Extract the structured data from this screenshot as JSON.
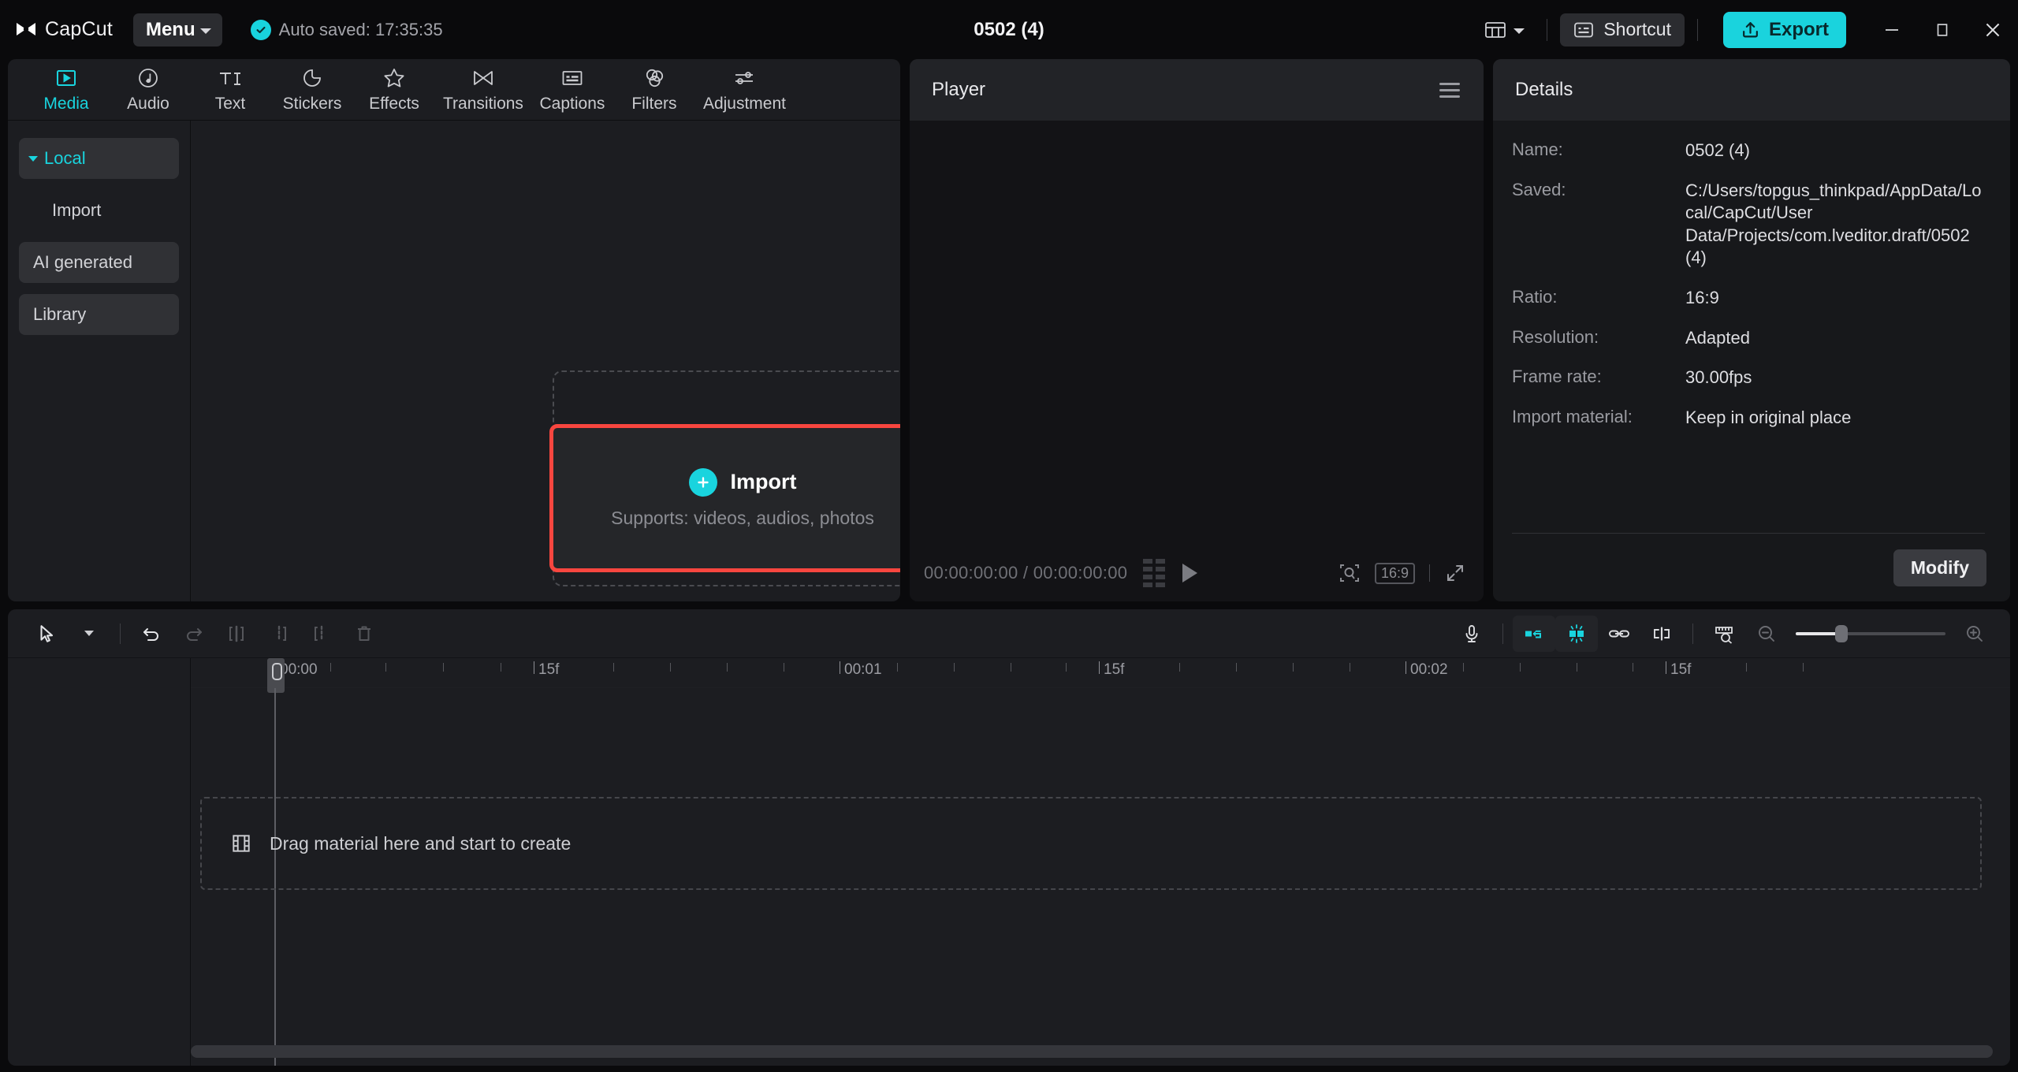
{
  "app": {
    "brand": "CapCut",
    "menu_label": "Menu",
    "autosave": "Auto saved: 17:35:35",
    "project_title": "0502 (4)",
    "shortcut_label": "Shortcut",
    "export_label": "Export",
    "icons": {
      "brand": "capcut-logo-icon",
      "autosave_check": "check-circle-icon",
      "menu_caret": "chevron-down-icon",
      "layout": "layout-icon",
      "layout_caret": "chevron-down-icon",
      "shortcut": "keyboard-icon",
      "export": "upload-icon",
      "minimize": "minimize-icon",
      "maximize": "maximize-icon",
      "close": "close-icon"
    }
  },
  "tabs": [
    {
      "label": "Media",
      "icon": "media-play-icon",
      "active": true
    },
    {
      "label": "Audio",
      "icon": "audio-note-icon",
      "active": false
    },
    {
      "label": "Text",
      "icon": "text-ti-icon",
      "active": false
    },
    {
      "label": "Stickers",
      "icon": "sticker-icon",
      "active": false
    },
    {
      "label": "Effects",
      "icon": "effects-star-icon",
      "active": false
    },
    {
      "label": "Transitions",
      "icon": "transitions-icon",
      "active": false
    },
    {
      "label": "Captions",
      "icon": "captions-icon",
      "active": false
    },
    {
      "label": "Filters",
      "icon": "filters-circles-icon",
      "active": false
    },
    {
      "label": "Adjustment",
      "icon": "adjustment-sliders-icon",
      "active": false
    }
  ],
  "sidebar": {
    "items": [
      {
        "label": "Local",
        "style": "group"
      },
      {
        "label": "Import",
        "style": "plain"
      },
      {
        "label": "AI generated",
        "style": "boxed"
      },
      {
        "label": "Library",
        "style": "boxed"
      }
    ]
  },
  "media": {
    "import_label": "Import",
    "import_sub": "Supports: videos, audios, photos",
    "plus_icon": "plus-circle-icon"
  },
  "player": {
    "title": "Player",
    "menu_icon": "hamburger-icon",
    "current_time": "00:00:00:00",
    "separator": "/",
    "total_time": "00:00:00:00",
    "timecode": "00:00:00:00 / 00:00:00:00",
    "ratio_chip": "16:9",
    "icons": {
      "grid": "grid-view-icon",
      "play": "play-icon",
      "zoom_fit": "zoom-fit-icon",
      "fullscreen": "fullscreen-icon"
    }
  },
  "details": {
    "title": "Details",
    "rows": [
      {
        "label": "Name:",
        "value": "0502 (4)"
      },
      {
        "label": "Saved:",
        "value": "C:/Users/topgus_thinkpad/AppData/Local/CapCut/User Data/Projects/com.lveditor.draft/0502 (4)"
      },
      {
        "label": "Ratio:",
        "value": "16:9"
      },
      {
        "label": "Resolution:",
        "value": "Adapted"
      },
      {
        "label": "Frame rate:",
        "value": "30.00fps"
      },
      {
        "label": "Import material:",
        "value": "Keep in original place"
      }
    ],
    "modify_label": "Modify"
  },
  "timeline": {
    "tools_left": [
      {
        "name": "select-arrow-icon"
      },
      {
        "name": "chevron-down-icon"
      },
      {
        "name": "undo-icon"
      },
      {
        "name": "redo-icon"
      },
      {
        "name": "split-icon"
      },
      {
        "name": "trim-left-icon"
      },
      {
        "name": "trim-right-icon"
      },
      {
        "name": "delete-icon"
      }
    ],
    "tools_right": [
      {
        "name": "microphone-icon"
      },
      {
        "name": "mirror-icon"
      },
      {
        "name": "freeze-icon"
      },
      {
        "name": "link-icon"
      },
      {
        "name": "split-marker-icon"
      },
      {
        "name": "ruler-zoom-icon"
      },
      {
        "name": "zoom-out-icon"
      },
      {
        "name": "zoom-in-icon"
      }
    ],
    "ruler_labels": [
      "00:00",
      "15f",
      "00:01",
      "15f",
      "00:02",
      "15f"
    ],
    "placeholder": "Drag material here and start to create",
    "placeholder_icon": "film-strip-icon"
  },
  "colors": {
    "accent": "#19d4de",
    "highlight_box": "#f8463f",
    "panel_bg": "#1c1d21",
    "window_bg": "#0a0a0c",
    "text_primary": "#e9e9ec",
    "text_muted": "#9a9ba1"
  }
}
